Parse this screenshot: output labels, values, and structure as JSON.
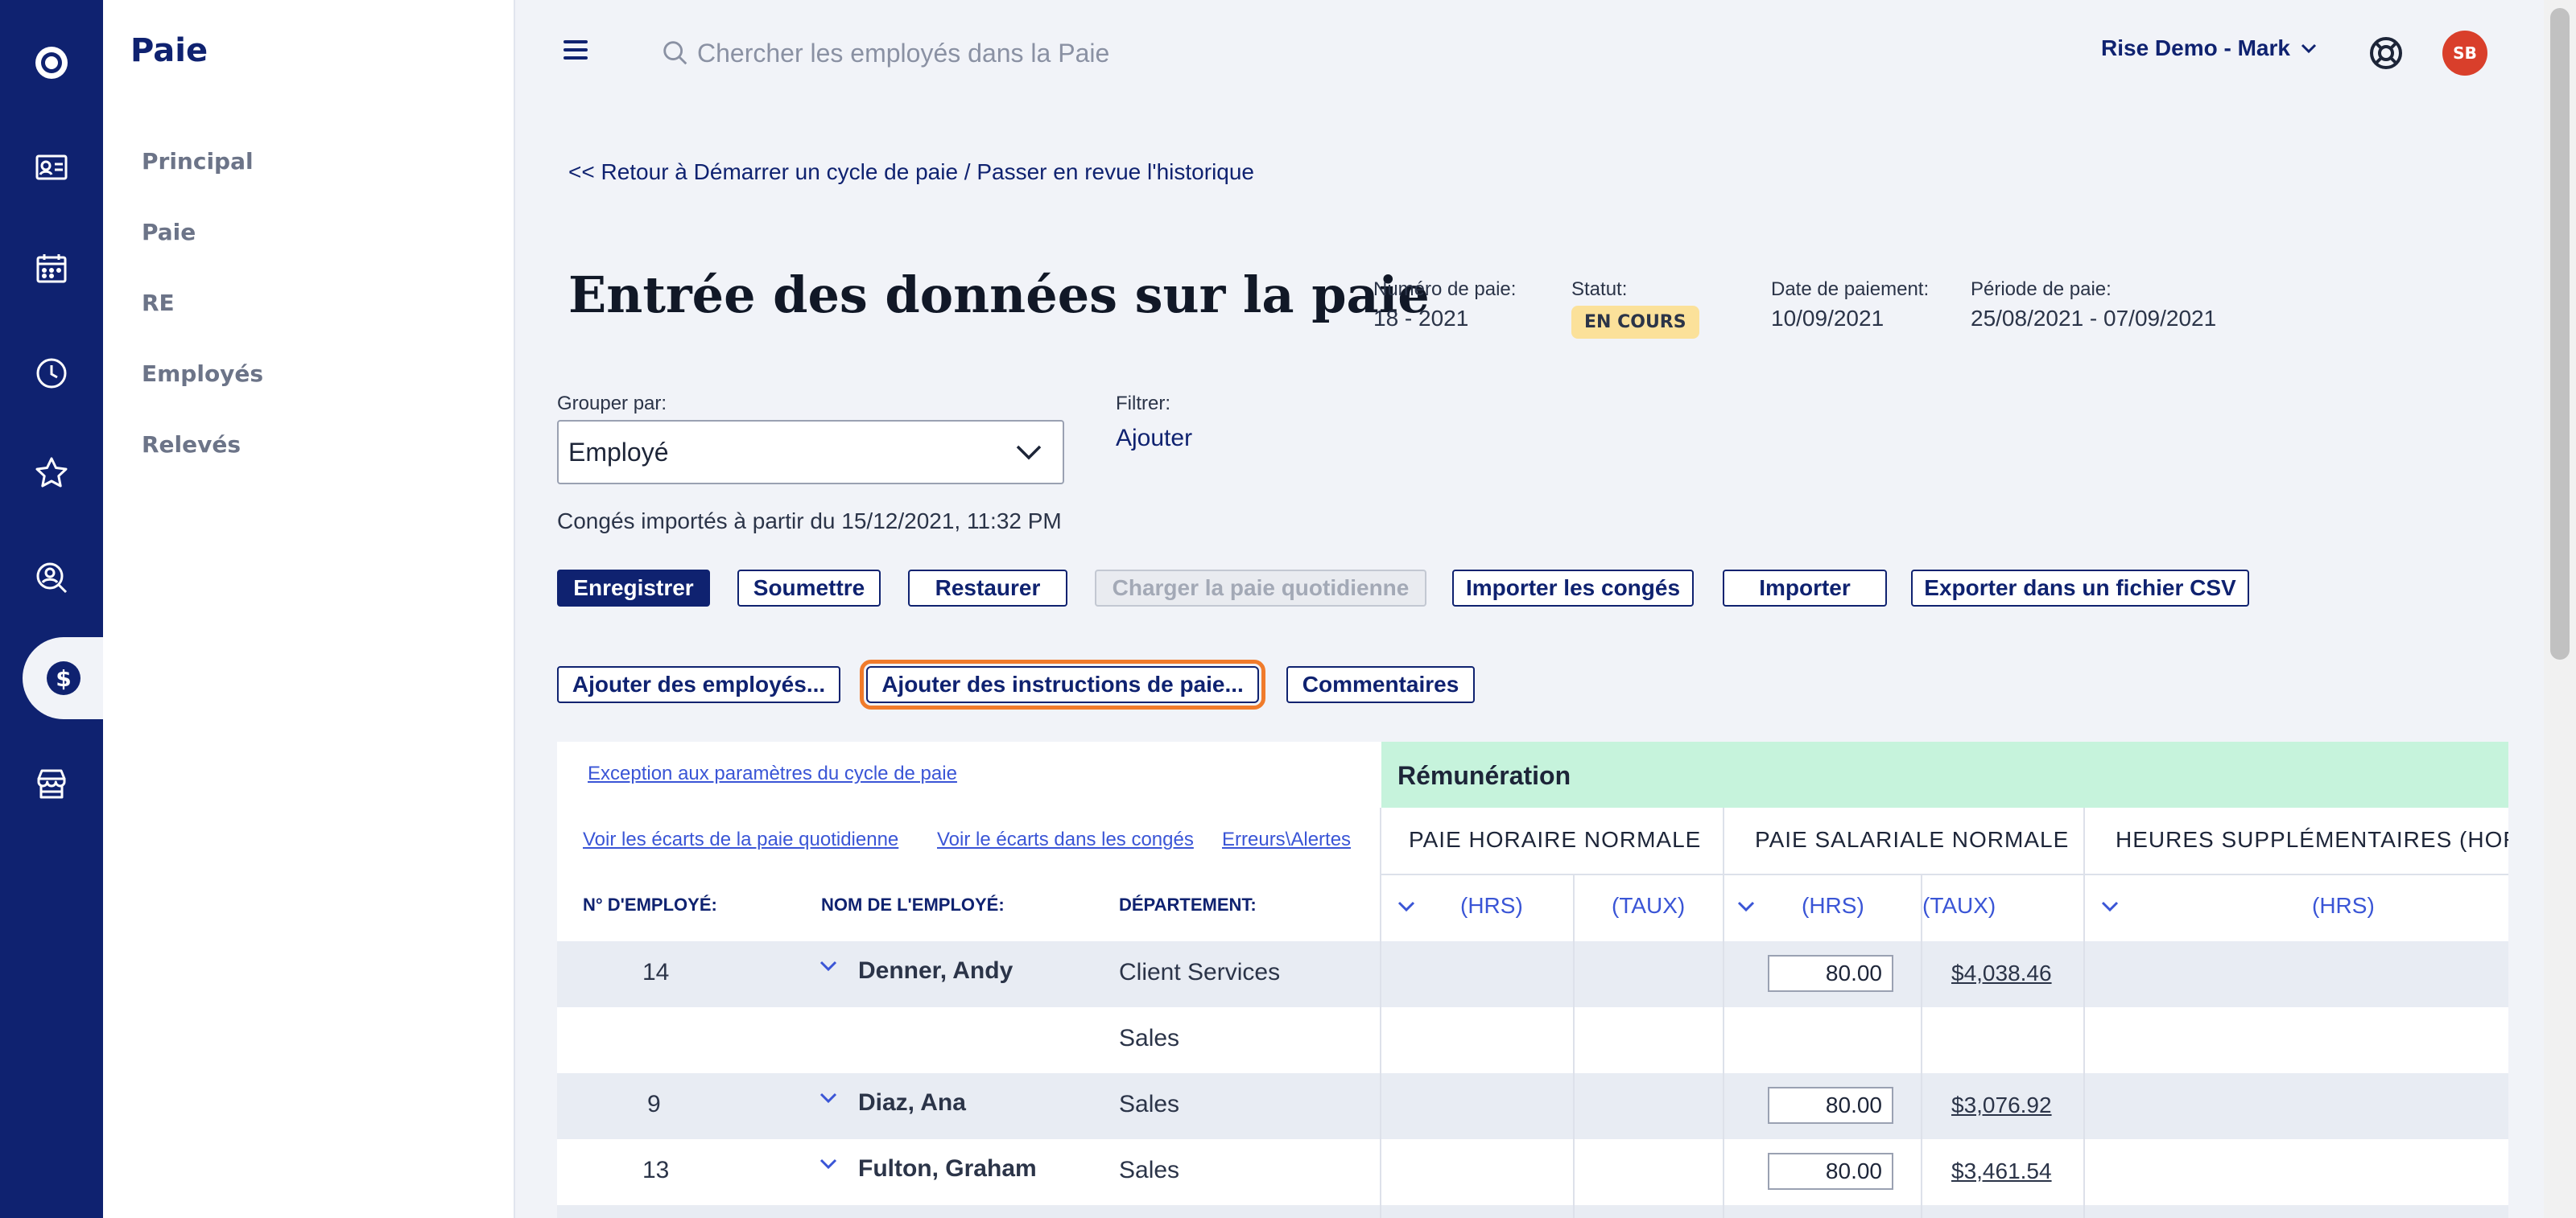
{
  "search": {
    "placeholder": "Chercher les employés dans la Paie"
  },
  "account": {
    "label": "Rise Demo - Mark"
  },
  "avatar": {
    "initials": "SB"
  },
  "subnav": {
    "title": "Paie",
    "items": [
      {
        "label": "Principal"
      },
      {
        "label": "Paie"
      },
      {
        "label": "RE"
      },
      {
        "label": "Employés"
      },
      {
        "label": "Relevés"
      }
    ]
  },
  "rail": {
    "icons": [
      "logo-icon",
      "employee-card-icon",
      "calendar-icon",
      "clock-icon",
      "star-icon",
      "search-person-icon",
      "dollar-icon",
      "store-icon"
    ],
    "active": "dollar-icon"
  },
  "back_link": "<< Retour à Démarrer un cycle de paie / Passer en revue l'historique",
  "page_title": "Entrée des données sur la paie",
  "meta": {
    "pay_number_label": "Numéro de paie:",
    "pay_number": "18 - 2021",
    "status_label": "Statut:",
    "status": "EN COURS",
    "pay_date_label": "Date de paiement:",
    "pay_date": "10/09/2021",
    "pay_period_label": "Période de paie:",
    "pay_period": "25/08/2021 - 07/09/2021"
  },
  "group_by": {
    "label": "Grouper par:",
    "value": "Employé"
  },
  "filter": {
    "label": "Filtrer:",
    "add": "Ajouter"
  },
  "leave_imported": "Congés importés à partir du 15/12/2021, 11:32 PM",
  "toolbar": {
    "save": "Enregistrer",
    "submit": "Soumettre",
    "restore": "Restaurer",
    "load_daily": "Charger la paie quotidienne",
    "import_leave": "Importer les congés",
    "import": "Importer",
    "export_csv": "Exporter dans un fichier CSV",
    "add_employees": "Ajouter des employés...",
    "add_instructions": "Ajouter des instructions de paie...",
    "comments": "Commentaires"
  },
  "table": {
    "exception_link": "Exception aux paramètres du cycle de paie",
    "links": [
      "Voir les écarts de la paie quotidienne",
      "Voir le écarts dans les congés",
      "Erreurs\\Alertes"
    ],
    "remuneration_header": "Rémunération",
    "group_headers": [
      "PAIE HORAIRE NORMALE",
      "PAIE SALARIALE NORMALE",
      "HEURES SUPPLÉMENTAIRES (HORAIRE"
    ],
    "columns": {
      "emp_no": "N° D'EMPLOYÉ:",
      "emp_name": "NOM DE L'EMPLOYÉ:",
      "department": "DÉPARTEMENT:"
    },
    "units": {
      "hrs": "(HRS)",
      "rate": "(TAUX)"
    },
    "rows": [
      {
        "emp_no": "14",
        "name": "Denner, Andy",
        "department": "Client Services",
        "salary_hrs": "80.00",
        "salary_rate": "$4,038.46 "
      },
      {
        "emp_no": "",
        "name": "",
        "department": "Sales",
        "salary_hrs": "",
        "salary_rate": ""
      },
      {
        "emp_no": "9",
        "name": "Diaz, Ana",
        "department": "Sales",
        "salary_hrs": "80.00",
        "salary_rate": "$3,076.92 "
      },
      {
        "emp_no": "13",
        "name": "Fulton, Graham",
        "department": "Sales",
        "salary_hrs": "80.00",
        "salary_rate": "$3,461.54 "
      }
    ]
  },
  "colors": {
    "navy": "#0f2270",
    "remuneration_bg": "#c6f3dc",
    "status_badge": "#fbe19a",
    "focus_outline": "#f07b2b",
    "avatar": "#d93f2b"
  }
}
